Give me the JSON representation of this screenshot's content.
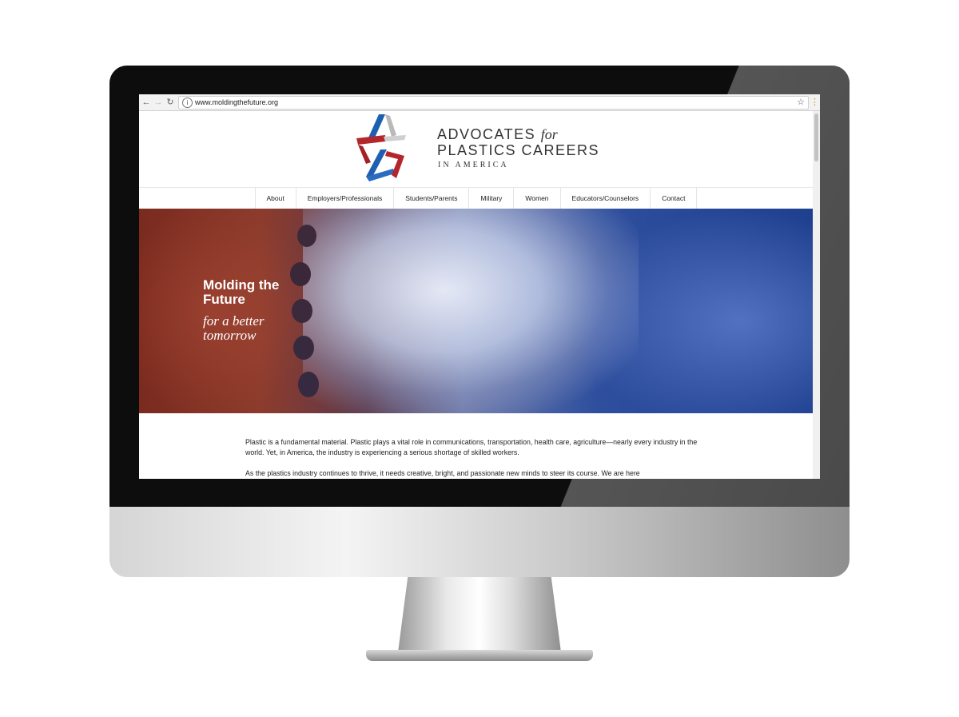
{
  "browser": {
    "back_icon": "arrow-left-icon",
    "forward_icon": "arrow-right-icon",
    "reload_icon": "reload-icon",
    "url": "www.moldingthefuture.org"
  },
  "logo": {
    "line1": "ADVOCATES",
    "line1_italic": "for",
    "line2": "PLASTICS CAREERS",
    "line3": "IN AMERICA",
    "colors": {
      "red": "#b3262c",
      "blue": "#1f5fb0",
      "grey": "#b9b9b9"
    }
  },
  "nav": {
    "items": [
      {
        "label": "About"
      },
      {
        "label": "Employers/Professionals"
      },
      {
        "label": "Students/Parents"
      },
      {
        "label": "Military"
      },
      {
        "label": "Women"
      },
      {
        "label": "Educators/Counselors"
      },
      {
        "label": "Contact"
      }
    ]
  },
  "hero": {
    "title_line1": "Molding the",
    "title_line2": "Future",
    "sub_line1": "for a better",
    "sub_line2": "tomorrow"
  },
  "content": {
    "p1": "Plastic is a fundamental material. Plastic plays a vital role in communications, transportation, health care, agriculture—nearly every industry in the world. Yet, in America, the industry is experiencing a serious shortage of skilled workers.",
    "p2": "As the plastics industry continues to thrive, it needs creative, bright, and passionate new minds to steer its course. We are here"
  }
}
